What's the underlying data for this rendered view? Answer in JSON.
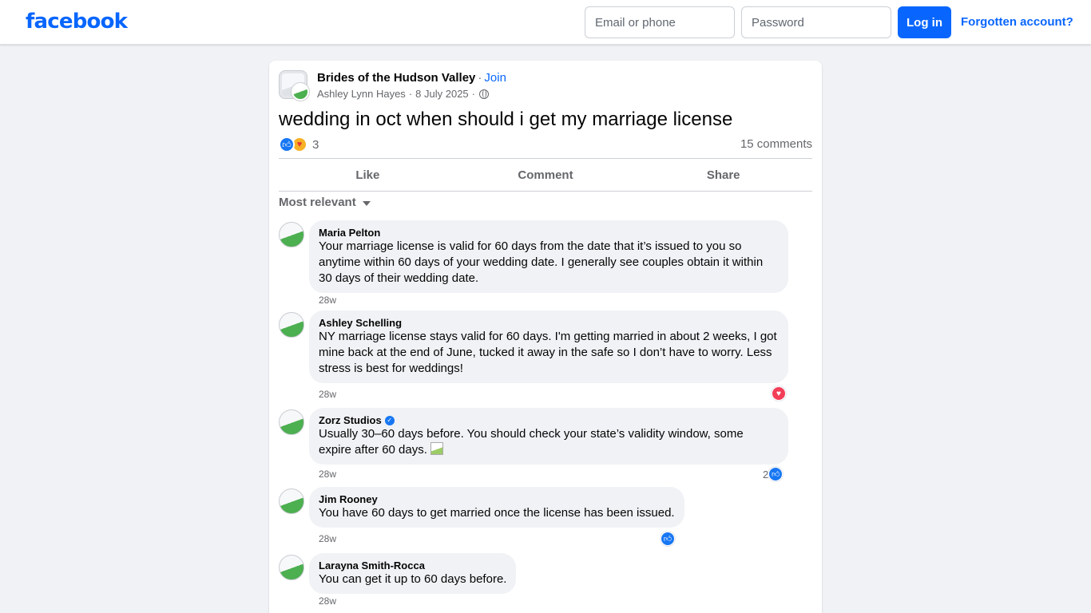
{
  "header": {
    "logo": "facebook",
    "email_placeholder": "Email or phone",
    "password_placeholder": "Password",
    "login_label": "Log in",
    "forgot_label": "Forgotten account?"
  },
  "post": {
    "group_name": "Brides of the Hudson Valley",
    "join_label": "Join",
    "author": "Ashley Lynn Hayes",
    "date": "8 July 2025",
    "text": "wedding in oct when should i get my marriage license",
    "reaction_count": "3",
    "comment_count": "15 comments",
    "actions": {
      "like": "Like",
      "comment": "Comment",
      "share": "Share"
    },
    "sort_label": "Most relevant"
  },
  "comments": [
    {
      "name": "Maria Pelton",
      "text": "Your marriage license is valid for 60 days from the date that it’s issued to you so anytime within 60 days of your wedding date. I generally see couples obtain it within 30 days of their wedding date.",
      "time": "28w"
    },
    {
      "name": "Ashley Schelling",
      "text": "NY marriage license stays valid for 60 days. I'm getting married in about 2 weeks, I got mine back at the end of June, tucked it away in the safe so I don’t have to worry. Less stress is best for weddings!",
      "time": "28w",
      "reaction": "love-icon"
    },
    {
      "name": "Zorz Studios",
      "verified": true,
      "text": "Usually 30–60 days before. You should check your state’s validity window, some expire after 60 days.",
      "time": "28w",
      "reaction": "like-icon",
      "reaction_count": "2"
    },
    {
      "name": "Jim Rooney",
      "text": "You have 60 days to get married once the license has been issued.",
      "time": "28w",
      "reaction": "like-icon"
    },
    {
      "name": "Larayna Smith-Rocca",
      "text": "You can get it up to 60 days before.",
      "time": "28w"
    }
  ],
  "colors": {
    "brand_blue": "#0866ff",
    "like_blue": "#1877f2",
    "love_red": "#f33e58",
    "bubble_bg": "#f0f2f5",
    "page_bg": "#f0f2f5"
  }
}
